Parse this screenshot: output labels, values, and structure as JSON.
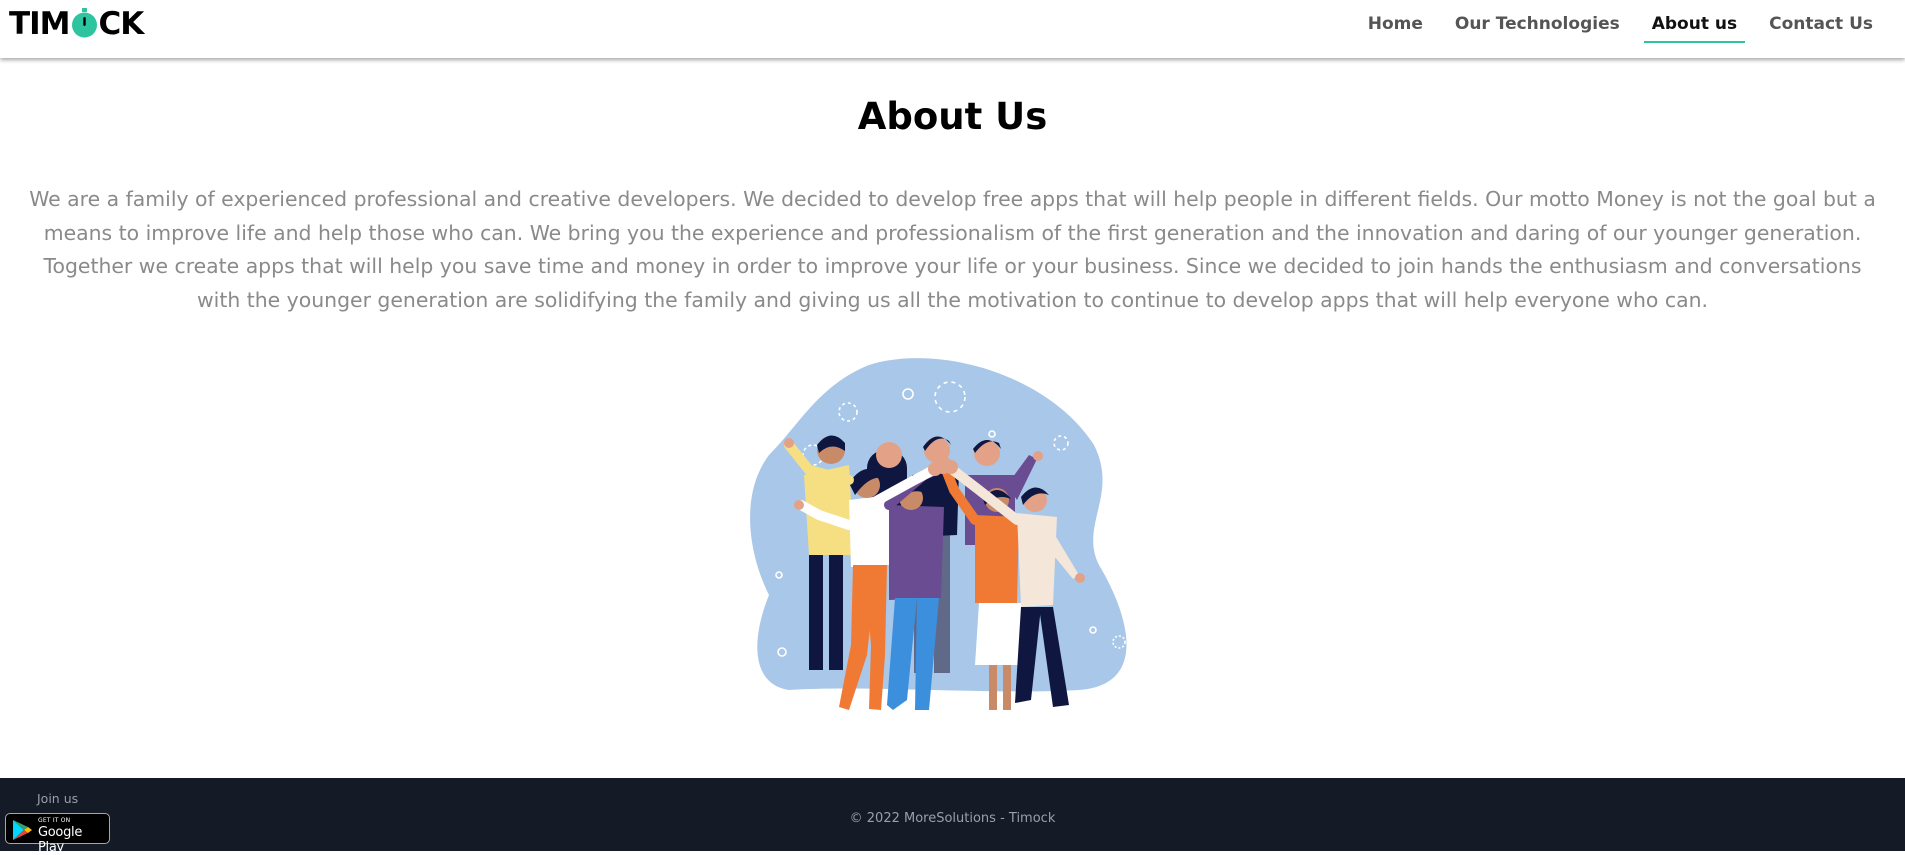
{
  "brand": {
    "name_part1": "TIM",
    "name_part2": "CK"
  },
  "nav": {
    "items": [
      {
        "label": "Home",
        "active": false
      },
      {
        "label": "Our Technologies",
        "active": false
      },
      {
        "label": "About us",
        "active": true
      },
      {
        "label": "Contact Us",
        "active": false
      }
    ]
  },
  "main": {
    "title": "About Us",
    "body": "We are a family of experienced professional and creative developers. We decided to develop free apps that will help people in different fields. Our motto Money is not the goal but a means to improve life and help those who can. We bring you the experience and professionalism of the first generation and the innovation and daring of our younger generation. Together we create apps that will help you save time and money in order to improve your life or your business. Since we decided to join hands the enthusiasm and conversations with the younger generation are solidifying the family and giving us all the motivation to continue to develop apps that will help everyone who can."
  },
  "footer": {
    "join_label": "Join us",
    "badge_small": "GET IT ON",
    "badge_big": "Google Play",
    "copyright": "© 2022 MoreSolutions - Timock"
  },
  "colors": {
    "accent": "#2ec4a0",
    "footer_bg": "#141a26",
    "blob": "#a9c7e8"
  },
  "icons": {
    "logo_o": "stopwatch-icon",
    "play": "google-play-icon"
  }
}
